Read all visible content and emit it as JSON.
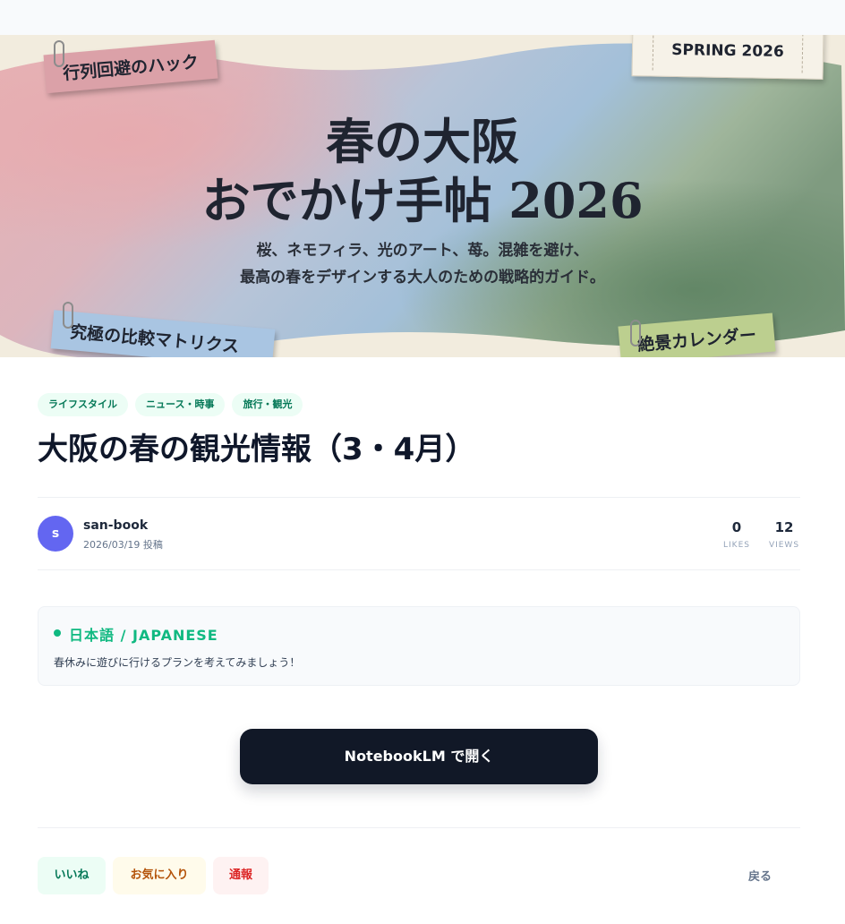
{
  "hero": {
    "title_line1": "春の大阪",
    "title_line2": "おでかけ手帖 2026",
    "subtitle_line1": "桜、ネモフィラ、光のアート、苺。混雑を避け、",
    "subtitle_line2": "最高の春をデザインする大人のための戦略的ガイド。",
    "note_pink": "行列回避のハック",
    "note_blue": "究極の比較マトリクス",
    "note_green": "絶景カレンダー",
    "ticket": "SPRING 2026"
  },
  "post": {
    "tags": [
      "ライフスタイル",
      "ニュース・時事",
      "旅行・観光"
    ],
    "title": "大阪の春の観光情報（3・4月）",
    "author": {
      "initial": "s",
      "name": "san-book",
      "date": "2026/03/19 投稿"
    },
    "stats": {
      "likes_value": "0",
      "likes_label": "LIKES",
      "views_value": "12",
      "views_label": "VIEWS"
    },
    "language": {
      "label": "日本語 / JAPANESE",
      "text": "春休みに遊びに行けるプランを考えてみましょう！"
    },
    "open_button": "NotebookLM で開く"
  },
  "actions": {
    "like": "いいね",
    "favorite": "お気に入り",
    "report": "通報",
    "back": "戻る"
  },
  "colors": {
    "accent_green": "#10b981",
    "button_dark": "#111827",
    "avatar": "#6366f1"
  }
}
